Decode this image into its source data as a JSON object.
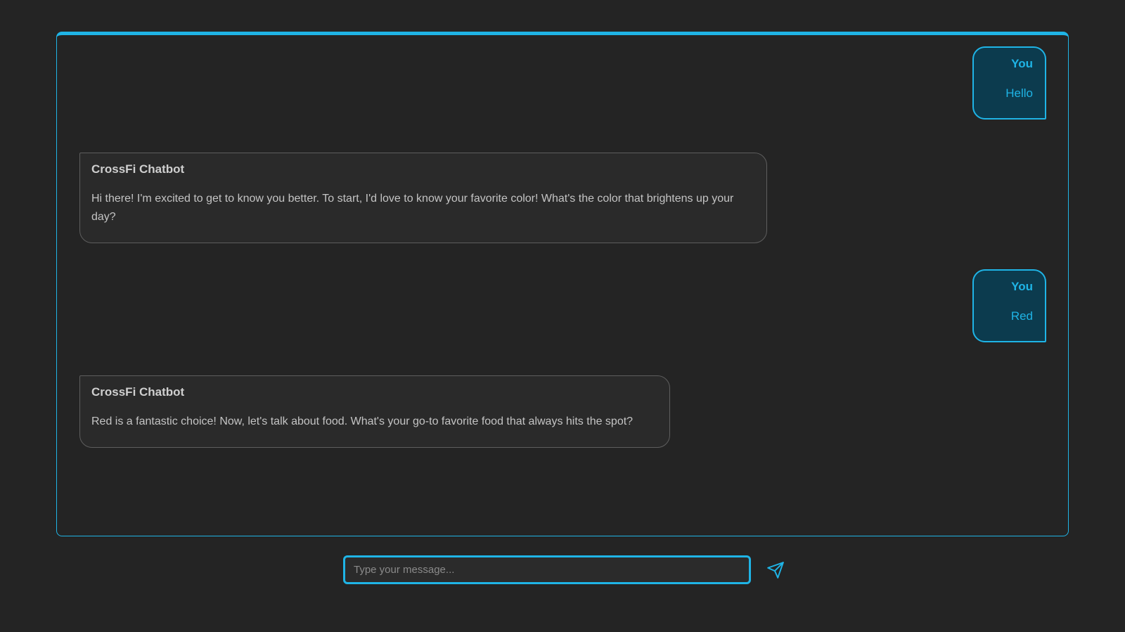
{
  "colors": {
    "background": "#242424",
    "accent": "#1fb4e6",
    "user_bubble_bg": "#0c3b4e",
    "bot_bubble_bg": "#2a2a2a",
    "bot_border": "#5e5e5e",
    "bot_text": "#c4c4c4"
  },
  "messages": [
    {
      "role": "user",
      "sender": "You",
      "text": "Hello"
    },
    {
      "role": "bot",
      "sender": "CrossFi Chatbot",
      "text": "Hi there! I'm excited to get to know you better. To start, I'd love to know your favorite color! What's the color that brightens up your day?"
    },
    {
      "role": "user",
      "sender": "You",
      "text": "Red"
    },
    {
      "role": "bot",
      "sender": "CrossFi Chatbot",
      "text": "Red is a fantastic choice! Now, let's talk about food. What's your go-to favorite food that always hits the spot?"
    }
  ],
  "composer": {
    "placeholder": "Type your message...",
    "value": "",
    "send_icon": "send-icon"
  }
}
